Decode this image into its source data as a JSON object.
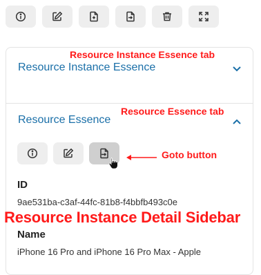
{
  "toolbar": {
    "buttons": [
      {
        "icon": "info-circle-icon"
      },
      {
        "icon": "edit-icon"
      },
      {
        "icon": "file-plus-icon"
      },
      {
        "icon": "file-goto-icon"
      },
      {
        "icon": "trash-icon"
      },
      {
        "icon": "expand-icon"
      }
    ]
  },
  "sections": {
    "instance_essence": {
      "title": "Resource Instance Essence",
      "expanded": false
    },
    "resource_essence": {
      "title": "Resource Essence",
      "expanded": true,
      "toolbar": {
        "buttons": [
          {
            "icon": "info-circle-icon"
          },
          {
            "icon": "edit-icon"
          },
          {
            "icon": "goto-icon",
            "active": true
          }
        ]
      },
      "fields": {
        "id_label": "ID",
        "id_value": "9ae531ba-c3af-44fc-81b8-f4bbfb493c0e",
        "name_label": "Name",
        "name_value": "iPhone 16 Pro and iPhone 16 Pro Max - Apple"
      }
    }
  },
  "annotations": {
    "instance_tab": "Resource Instance Essence tab",
    "essence_tab": "Resource Essence tab",
    "goto_button": "Goto button",
    "sidebar": "Resource Instance Detail Sidebar"
  },
  "colors": {
    "link_blue": "#1a6fa8",
    "annotation_red": "#ff1a1a",
    "button_bg": "#eeeeee",
    "button_active_bg": "#cfcfcf"
  }
}
